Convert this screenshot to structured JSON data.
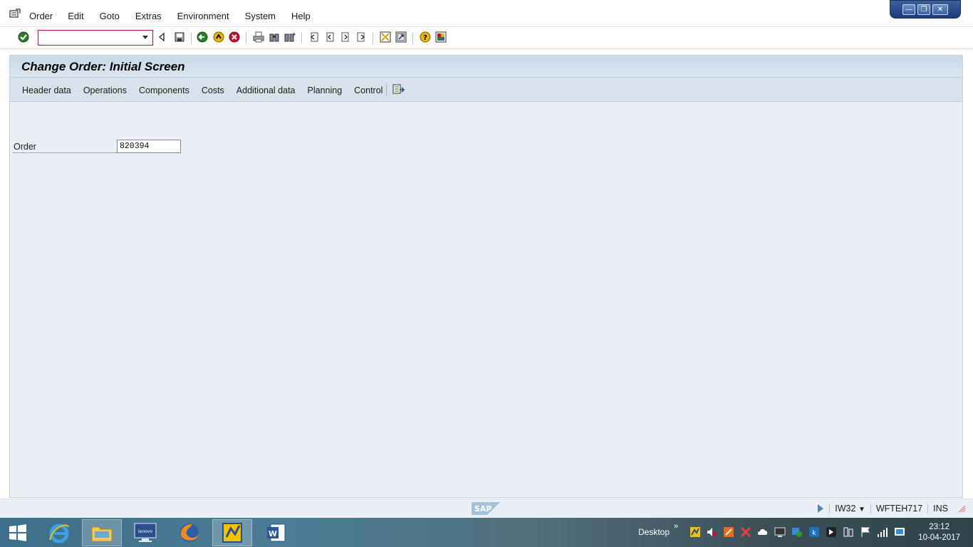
{
  "menu": {
    "items": [
      "Order",
      "Edit",
      "Goto",
      "Extras",
      "Environment",
      "System",
      "Help"
    ]
  },
  "window_controls": {
    "minimize": "—",
    "restore": "❐",
    "close": "✕"
  },
  "toolbar": {
    "command_field_value": "",
    "icons": [
      "enter-icon",
      "save-icon",
      "back-icon",
      "exit-icon",
      "cancel-icon",
      "print-icon",
      "find-icon",
      "find-next-icon",
      "first-page-icon",
      "previous-page-icon",
      "next-page-icon",
      "last-page-icon",
      "create-session-icon",
      "shortcut-icon",
      "help-icon",
      "customize-layout-icon"
    ]
  },
  "screen": {
    "title": "Change Order: Initial Screen",
    "app_toolbar": [
      "Header data",
      "Operations",
      "Components",
      "Costs",
      "Additional data",
      "Planning",
      "Control"
    ]
  },
  "form": {
    "order_label": "Order",
    "order_value": "820394"
  },
  "statusbar": {
    "transaction": "IW32",
    "server": "WFTEH717",
    "mode": "INS"
  },
  "taskbar": {
    "desktop_label": "Desktop",
    "chevron": "»",
    "time": "23:12",
    "date": "10-04-2017"
  },
  "colors": {
    "accent": "#c8102e",
    "frame_bg": "#e9eff5",
    "title_bg": "#c9d9e8"
  }
}
